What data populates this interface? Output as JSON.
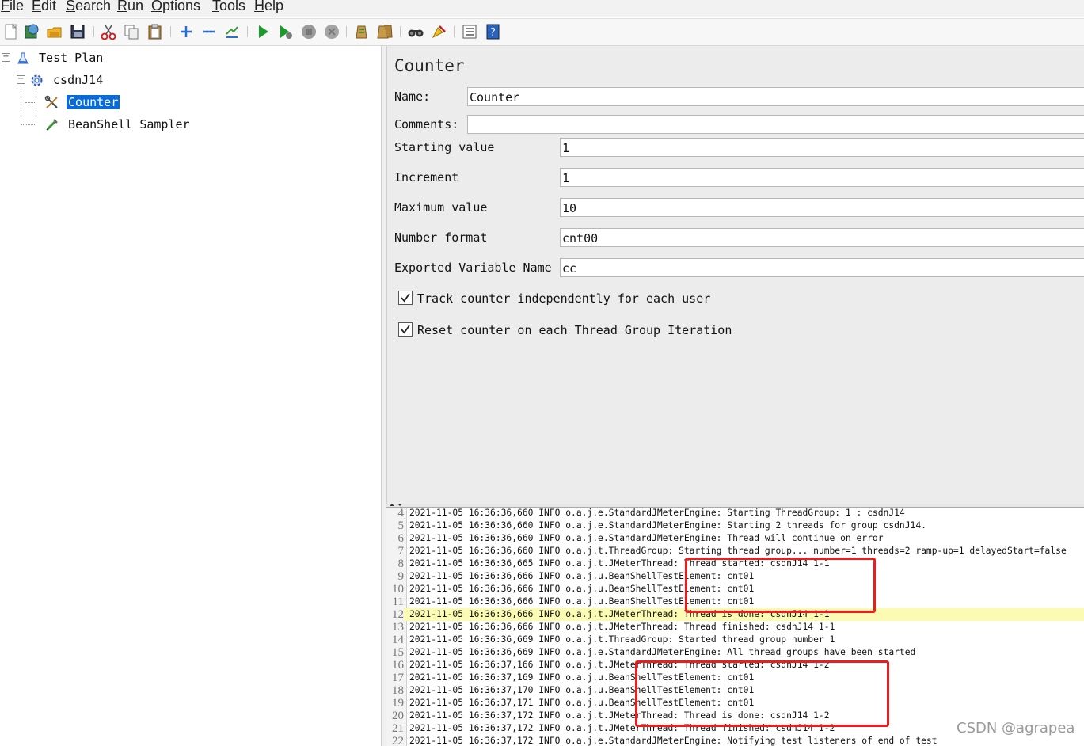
{
  "menu": [
    "File",
    "Edit",
    "Search",
    "Run",
    "Options",
    "Tools",
    "Help"
  ],
  "toolbar": {
    "icons": [
      "new-icon",
      "templates-icon",
      "open-icon",
      "save-icon",
      "cut-icon",
      "copy-icon",
      "paste-icon",
      "expand-icon",
      "collapse-icon",
      "toggle-icon",
      "start-icon",
      "start-no-pause-icon",
      "stop-icon",
      "shutdown-icon",
      "clear-icon",
      "clear-all-icon",
      "search-icon",
      "reset-search-icon",
      "function-helper-icon",
      "help-icon"
    ]
  },
  "tree": {
    "nodes": [
      {
        "label": "Test Plan"
      },
      {
        "label": "csdnJ14"
      },
      {
        "label": "Counter",
        "selected": true
      },
      {
        "label": "BeanShell Sampler"
      }
    ]
  },
  "form": {
    "title": "Counter",
    "name_label": "Name:",
    "name_value": "Counter",
    "comments_label": "Comments:",
    "comments_value": "",
    "start_label": "Starting value",
    "start_value": "1",
    "increment_label": "Increment",
    "increment_value": "1",
    "max_label": "Maximum value",
    "max_value": "10",
    "format_label": "Number format",
    "format_value": "cnt00",
    "export_label": "Exported Variable Name",
    "export_value": "cc",
    "track_label": "Track counter independently for each user",
    "track_checked": true,
    "reset_label": "Reset counter on each Thread Group Iteration",
    "reset_checked": true
  },
  "log": {
    "highlight_line": "12",
    "lines": [
      {
        "n": "4",
        "text": "2021-11-05 16:36:36,660 INFO o.a.j.e.StandardJMeterEngine: Starting ThreadGroup: 1 : csdnJ14"
      },
      {
        "n": "5",
        "text": "2021-11-05 16:36:36,660 INFO o.a.j.e.StandardJMeterEngine: Starting 2 threads for group csdnJ14."
      },
      {
        "n": "6",
        "text": "2021-11-05 16:36:36,660 INFO o.a.j.e.StandardJMeterEngine: Thread will continue on error"
      },
      {
        "n": "7",
        "text": "2021-11-05 16:36:36,660 INFO o.a.j.t.ThreadGroup: Starting thread group... number=1 threads=2 ramp-up=1 delayedStart=false"
      },
      {
        "n": "8",
        "text": "2021-11-05 16:36:36,665 INFO o.a.j.t.JMeterThread: Thread started: csdnJ14 1-1"
      },
      {
        "n": "9",
        "text": "2021-11-05 16:36:36,666 INFO o.a.j.u.BeanShellTestElement: cnt01"
      },
      {
        "n": "10",
        "text": "2021-11-05 16:36:36,666 INFO o.a.j.u.BeanShellTestElement: cnt01"
      },
      {
        "n": "11",
        "text": "2021-11-05 16:36:36,666 INFO o.a.j.u.BeanShellTestElement: cnt01"
      },
      {
        "n": "12",
        "text": "2021-11-05 16:36:36,666 INFO o.a.j.t.JMeterThread: Thread is done: csdnJ14 1-1"
      },
      {
        "n": "13",
        "text": "2021-11-05 16:36:36,666 INFO o.a.j.t.JMeterThread: Thread finished: csdnJ14 1-1"
      },
      {
        "n": "14",
        "text": "2021-11-05 16:36:36,669 INFO o.a.j.t.ThreadGroup: Started thread group number 1"
      },
      {
        "n": "15",
        "text": "2021-11-05 16:36:36,669 INFO o.a.j.e.StandardJMeterEngine: All thread groups have been started"
      },
      {
        "n": "16",
        "text": "2021-11-05 16:36:37,166 INFO o.a.j.t.JMeterThread: Thread started: csdnJ14 1-2"
      },
      {
        "n": "17",
        "text": "2021-11-05 16:36:37,169 INFO o.a.j.u.BeanShellTestElement: cnt01"
      },
      {
        "n": "18",
        "text": "2021-11-05 16:36:37,170 INFO o.a.j.u.BeanShellTestElement: cnt01"
      },
      {
        "n": "19",
        "text": "2021-11-05 16:36:37,171 INFO o.a.j.u.BeanShellTestElement: cnt01"
      },
      {
        "n": "20",
        "text": "2021-11-05 16:36:37,172 INFO o.a.j.t.JMeterThread: Thread is done: csdnJ14 1-2"
      },
      {
        "n": "21",
        "text": "2021-11-05 16:36:37,172 INFO o.a.j.t.JMeterThread: Thread finished: csdnJ14 1-2"
      },
      {
        "n": "22",
        "text": "2021-11-05 16:36:37,172 INFO o.a.j.e.StandardJMeterEngine: Notifying test listeners of end of test"
      }
    ]
  },
  "watermark": "CSDN @agrapea",
  "colors": {
    "selection": "#0a6bd8",
    "highlight": "#fbfbb4",
    "annotation": "#ee1c1c",
    "panel_bg": "#ececec"
  }
}
